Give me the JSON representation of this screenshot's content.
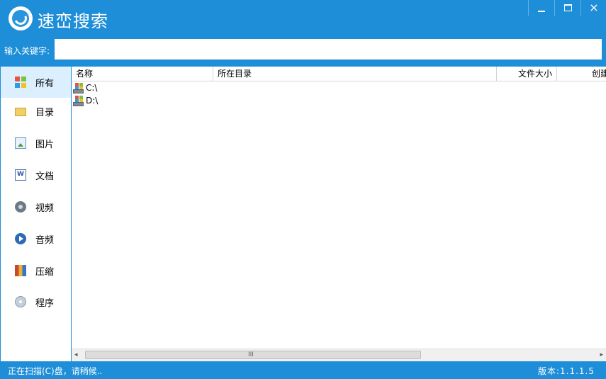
{
  "app": {
    "title": "速峦搜索"
  },
  "window_controls": {
    "minimize": "minimize-icon",
    "maximize": "maximize-icon",
    "close": "×"
  },
  "search": {
    "label": "输入关键字:",
    "value": "",
    "placeholder": ""
  },
  "sidebar": {
    "items": [
      {
        "label": "所有",
        "icon": "all-files-icon",
        "active": true
      },
      {
        "label": "目录",
        "icon": "folder-icon",
        "active": false
      },
      {
        "label": "图片",
        "icon": "picture-icon",
        "active": false
      },
      {
        "label": "文档",
        "icon": "document-icon",
        "active": false
      },
      {
        "label": "视频",
        "icon": "video-icon",
        "active": false
      },
      {
        "label": "音频",
        "icon": "audio-icon",
        "active": false
      },
      {
        "label": "压缩",
        "icon": "archive-icon",
        "active": false
      },
      {
        "label": "程序",
        "icon": "program-icon",
        "active": false
      }
    ]
  },
  "list": {
    "columns": [
      "名称",
      "所在目录",
      "文件大小",
      "创建"
    ],
    "rows": [
      {
        "name": "C:\\",
        "icon": "drive-icon"
      },
      {
        "name": "D:\\",
        "icon": "drive-icon"
      }
    ]
  },
  "scrollbar": {
    "left_arrow": "◂",
    "right_arrow": "▸",
    "grip": "III"
  },
  "status": {
    "message": "正在扫描(C)盘，请稍候..",
    "version": "版本:1.1.1.5"
  },
  "colors": {
    "accent": "#1e8ed8",
    "active_item_bg": "#dcefff"
  }
}
